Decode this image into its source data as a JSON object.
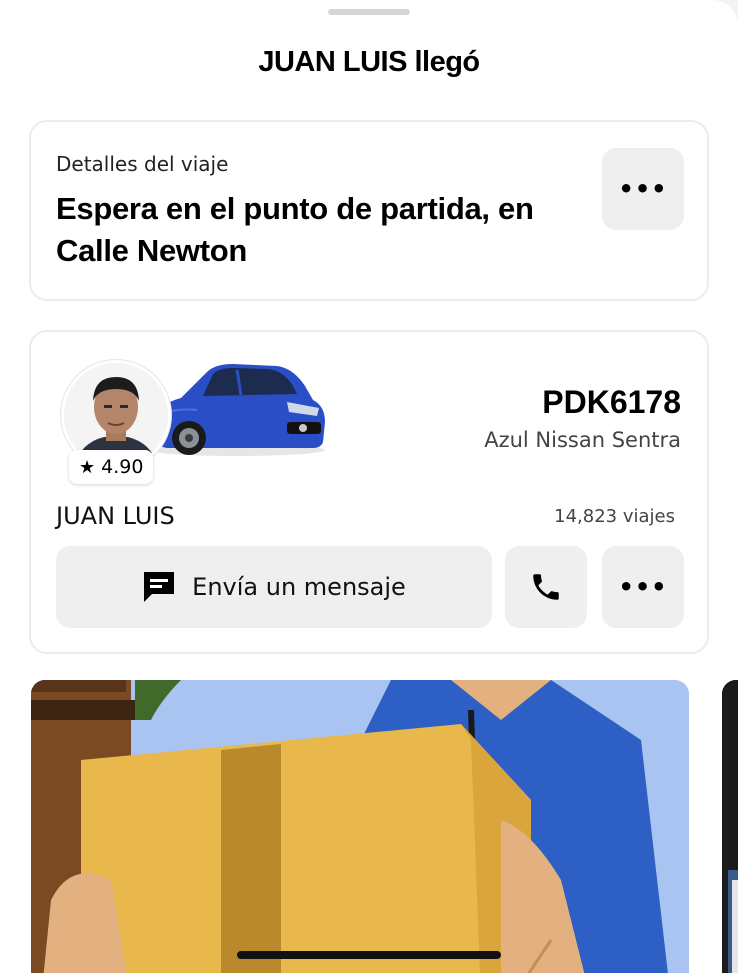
{
  "header": {
    "title": "JUAN LUIS llegó"
  },
  "trip_details": {
    "label": "Detalles del viaje",
    "heading": "Espera en el punto de partida, en Calle Newton",
    "more_icon": "more-horizontal-icon"
  },
  "driver": {
    "rating": "4.90",
    "rating_icon": "star-icon",
    "plate": "PDK6178",
    "car_model": "Azul Nissan Sentra",
    "name": "JUAN LUIS",
    "trips": "14,823 viajes",
    "car_color": "#2a4ec6"
  },
  "actions": {
    "message_label": "Envía un mensaje",
    "message_icon": "message-icon",
    "call_icon": "phone-icon",
    "more_icon": "more-horizontal-icon"
  },
  "promo": {
    "image": "person-holding-box-illustration"
  }
}
